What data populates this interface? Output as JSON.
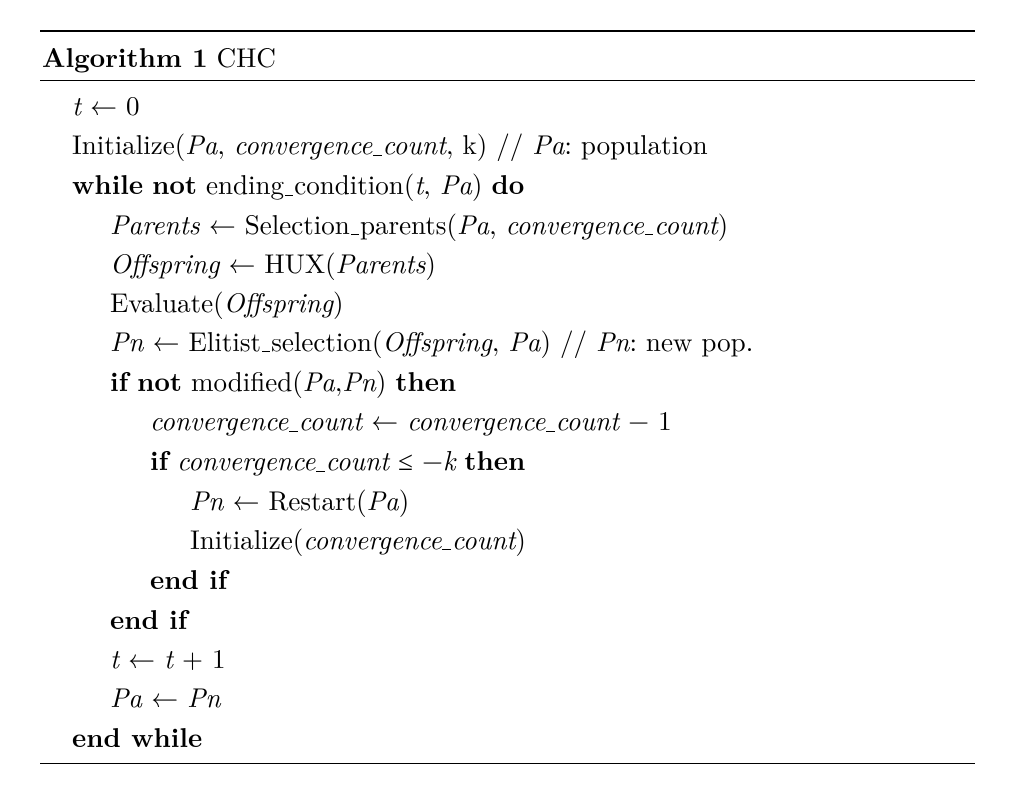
{
  "title_prefix": "Algorithm 1",
  "title_name": "CHC",
  "t": "t",
  "Pa": "Pa",
  "Pn": "Pn",
  "cc": "convergence",
  "cc2": "count",
  "k": "k",
  "zero": "0",
  "one": "1",
  "Parents": "Parents",
  "Offspring": "Offspring",
  "Initialize": "Initialize",
  "while": "while",
  "not": "not",
  "do": "do",
  "ending": "ending",
  "condition": "condition",
  "Selection": "Selection",
  "parents_word": "parents",
  "HUX": "HUX",
  "Evaluate": "Evaluate",
  "Elitist": "Elitist",
  "selection": "selection",
  "population_comment": ": population",
  "newpop_comment": ": new pop.",
  "if": "if",
  "then": "then",
  "modified": "modified",
  "Restart": "Restart",
  "endif": "end if",
  "endwhile": "end while",
  "slashes": "//",
  "larr": "←",
  "leq": "≤",
  "minus": "−",
  "plus": "+",
  "comma": ",",
  "lp": "(",
  "rp": ")"
}
